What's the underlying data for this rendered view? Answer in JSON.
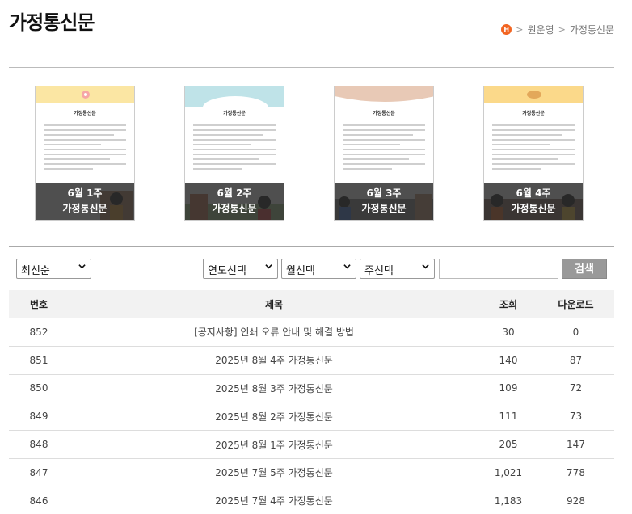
{
  "header": {
    "title": "가정통신문"
  },
  "breadcrumb": {
    "home_badge": "H",
    "sep": ">",
    "items": [
      "원운영",
      "가정통신문"
    ]
  },
  "thumbnails": [
    {
      "week": "6월 1주",
      "label": "가정통신문",
      "doc_title": "가정통신문",
      "accent": "#fbe6a3"
    },
    {
      "week": "6월 2주",
      "label": "가정통신문",
      "doc_title": "가정통신문",
      "accent": "#bfe3e8"
    },
    {
      "week": "6월 3주",
      "label": "가정통신문",
      "doc_title": "가정통신문",
      "accent": "#e8c9b6"
    },
    {
      "week": "6월 4주",
      "label": "가정통신문",
      "doc_title": "가정통신문",
      "accent": "#fbd98a"
    }
  ],
  "filters": {
    "sort": "최신순",
    "year": "연도선택",
    "month": "월선택",
    "week": "주선택",
    "search_value": "",
    "search_button": "검색"
  },
  "table": {
    "headers": {
      "no": "번호",
      "title": "제목",
      "views": "조회",
      "downloads": "다운로드"
    },
    "rows": [
      {
        "no": "852",
        "title": "[공지사항] 인쇄 오류 안내 및 해결 방법",
        "views": "30",
        "downloads": "0"
      },
      {
        "no": "851",
        "title": "2025년 8월 4주 가정통신문",
        "views": "140",
        "downloads": "87"
      },
      {
        "no": "850",
        "title": "2025년 8월 3주 가정통신문",
        "views": "109",
        "downloads": "72"
      },
      {
        "no": "849",
        "title": "2025년 8월 2주 가정통신문",
        "views": "111",
        "downloads": "73"
      },
      {
        "no": "848",
        "title": "2025년 8월 1주 가정통신문",
        "views": "205",
        "downloads": "147"
      },
      {
        "no": "847",
        "title": "2025년 7월 5주 가정통신문",
        "views": "1,021",
        "downloads": "778"
      },
      {
        "no": "846",
        "title": "2025년 7월 4주 가정통신문",
        "views": "1,183",
        "downloads": "928"
      }
    ]
  }
}
